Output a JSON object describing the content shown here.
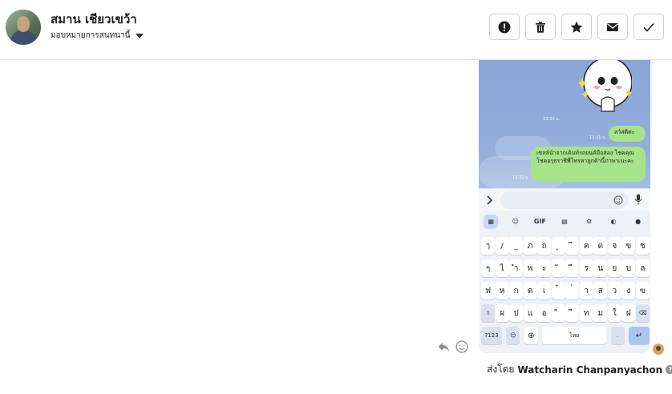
{
  "header": {
    "contact_name": "สมาน เชียวเขว้า",
    "assign_label": "มอบหมายการสนทนานี้"
  },
  "actions": [
    {
      "name": "spam-button",
      "icon": "alert-circle-icon"
    },
    {
      "name": "delete-button",
      "icon": "trash-icon"
    },
    {
      "name": "star-button",
      "icon": "star-icon"
    },
    {
      "name": "mark-unread-button",
      "icon": "envelope-icon"
    },
    {
      "name": "done-button",
      "icon": "check-icon"
    }
  ],
  "attachment": {
    "bubble_short": "สวัสดีค่ะ",
    "bubble_long": "เซลล์นำจากเต้นท์รถยนต์มือสอง โชคคุณโชคอรุธราชีพี่โทรหาลูกค้านี้ภาษาเนะคะ",
    "timestamps": [
      "13:31 น.",
      "13:31 น.",
      "13:32 น."
    ],
    "keyboard": {
      "row1": [
        "ๅ",
        "/",
        "_",
        "ภ",
        "ถ",
        "ุ",
        "ึ",
        "ค",
        "ต",
        "จ",
        "ข",
        "ช"
      ],
      "row2": [
        "ๆ",
        "ไ",
        "ำ",
        "พ",
        "ะ",
        "ั",
        "ี",
        "ร",
        "น",
        "ย",
        "บ",
        "ล"
      ],
      "row3": [
        "ฟ",
        "ห",
        "ก",
        "ด",
        "เ",
        "้",
        "่",
        "า",
        "ส",
        "ว",
        "ง",
        "ฃ"
      ],
      "row4": [
        "ผ",
        "ป",
        "แ",
        "อ",
        "ิ",
        "ื",
        "ท",
        "ม",
        "ใ",
        "ฝ"
      ],
      "num_key": "?123",
      "space_label": "ไทย",
      "gif_label": "GIF"
    }
  },
  "footer": {
    "sent_by_prefix": "ส่งโดย",
    "sender_name": "Watcharin Chanpanyachon"
  },
  "colors": {
    "chat_bg": "#8fa9d6",
    "bubble_green": "#a7e38a",
    "border": "#ccd0d5"
  }
}
